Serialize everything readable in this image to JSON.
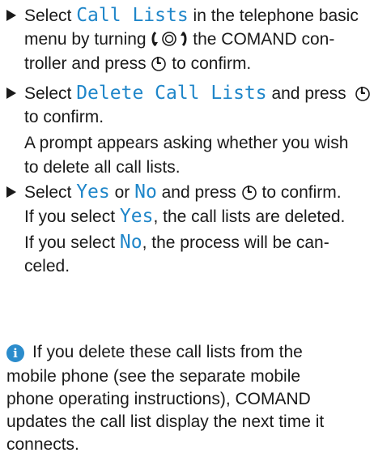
{
  "steps": [
    {
      "lines": [
        {
          "pre": "Select ",
          "hl": "Call Lists",
          "post": " in the telephone basic"
        },
        {
          "text_a": "menu by turning ",
          "text_b": " the COMAND con-"
        },
        {
          "text_a": "troller and press ",
          "text_b": " to confirm."
        }
      ]
    },
    {
      "lines": [
        {
          "pre": "Select ",
          "hl": "Delete Call Lists",
          "post": " and press"
        },
        {
          "text": "to confirm."
        },
        {
          "text": "A prompt appears asking whether you wish"
        },
        {
          "text": "to delete all call lists."
        }
      ]
    },
    {
      "lines": [
        {
          "a": "Select ",
          "hl1": "Yes",
          "b": " or ",
          "hl2": "No",
          "c": " and press ",
          "d": " to confirm."
        },
        {
          "a": "If you select ",
          "hl": "Yes",
          "b": ", the call lists are deleted."
        },
        {
          "a": "If you select ",
          "hl": "No",
          "b": ", the process will be can-"
        },
        {
          "text": "celed."
        }
      ]
    }
  ],
  "info": {
    "icon": "info-icon",
    "lines": [
      "If you delete these call lists from the",
      "mobile phone (see the separate mobile",
      "phone operating instructions), COMAND",
      "updates the call list display the next time it",
      "connects."
    ]
  },
  "colors": {
    "highlight": "#1f86c9",
    "info": "#2b8ccc",
    "text": "#1a1a1a"
  },
  "icons": [
    "turn-controller-icon",
    "press-controller-icon"
  ]
}
